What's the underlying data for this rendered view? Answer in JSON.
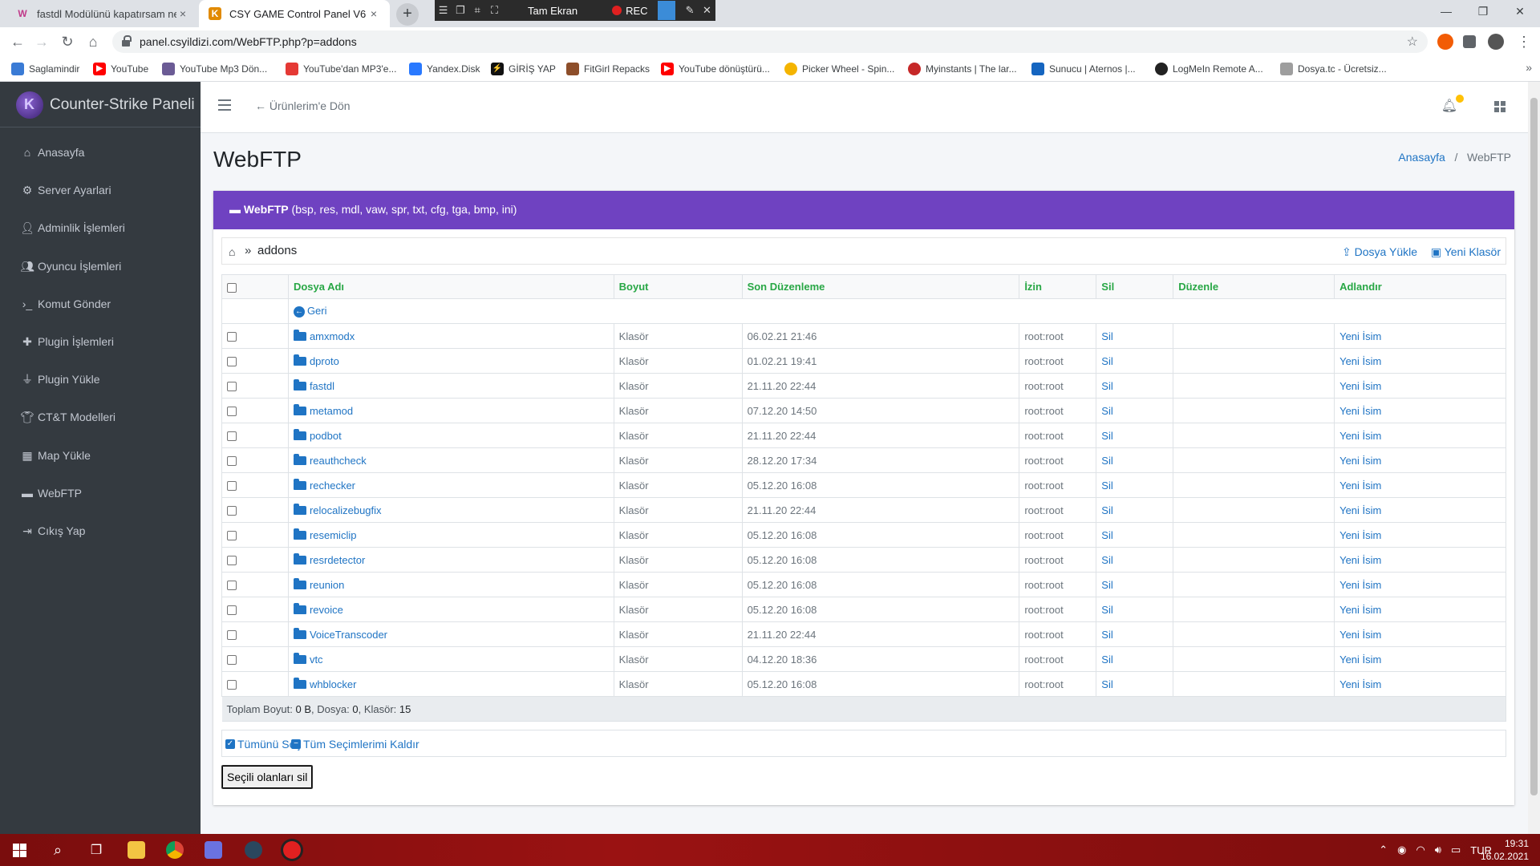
{
  "browser": {
    "tabs": [
      {
        "title": "fastdl Modülünü kapatırsam ne c",
        "active": false
      },
      {
        "title": "CSY GAME Control Panel V6",
        "active": true
      }
    ],
    "recorder": {
      "title": "Tam Ekran",
      "rec_label": "REC"
    },
    "url": "panel.csyildizi.com/WebFTP.php?p=addons",
    "bookmarks": [
      {
        "label": "Saglamindir",
        "icon_color": "#3a7bd5"
      },
      {
        "label": "YouTube",
        "icon_color": "#ff0000"
      },
      {
        "label": "YouTube Mp3 Dön...",
        "icon_color": "#6b5b95"
      },
      {
        "label": "YouTube'dan MP3'e...",
        "icon_color": "#e53935"
      },
      {
        "label": "Yandex.Disk",
        "icon_color": "#2979ff"
      },
      {
        "label": "GİRİŞ YAP",
        "icon_color": "#111111"
      },
      {
        "label": "FitGirl Repacks",
        "icon_color": "#8d4e2a"
      },
      {
        "label": "YouTube dönüştürü...",
        "icon_color": "#ff0000"
      },
      {
        "label": "Picker Wheel - Spin...",
        "icon_color": "#f4b400"
      },
      {
        "label": "Myinstants | The lar...",
        "icon_color": "#c62828"
      },
      {
        "label": "Sunucu | Aternos |...",
        "icon_color": "#1565c0"
      },
      {
        "label": "LogMeIn Remote A...",
        "icon_color": "#222222"
      },
      {
        "label": "Dosya.tc - Ücretsiz...",
        "icon_color": "#9e9e9e"
      }
    ]
  },
  "sidebar": {
    "brand": "Counter-Strike Paneli",
    "items": [
      {
        "label": "Anasayfa",
        "icon": "home-icon"
      },
      {
        "label": "Server Ayarlari",
        "icon": "cogs-icon"
      },
      {
        "label": "Adminlik İşlemleri",
        "icon": "user-icon"
      },
      {
        "label": "Oyuncu İşlemleri",
        "icon": "users-icon"
      },
      {
        "label": "Komut Gönder",
        "icon": "terminal-icon"
      },
      {
        "label": "Plugin İşlemleri",
        "icon": "puzzle-icon"
      },
      {
        "label": "Plugin Yükle",
        "icon": "plug-icon"
      },
      {
        "label": "CT&T Modelleri",
        "icon": "shirt-icon"
      },
      {
        "label": "Map Yükle",
        "icon": "map-icon"
      },
      {
        "label": "WebFTP",
        "icon": "folder-open-icon"
      },
      {
        "label": "Cıkış Yap",
        "icon": "sign-out-icon"
      }
    ]
  },
  "topnav": {
    "back_label": "Ürünlerim'e Dön"
  },
  "page": {
    "title": "WebFTP",
    "breadcrumb": {
      "home": "Anasayfa",
      "current": "WebFTP"
    }
  },
  "card": {
    "header_bold": "WebFTP",
    "header_rest": " (bsp, res, mdl, vaw, spr, txt, cfg, tga, bmp, ini)",
    "path": "addons",
    "upload_label": "Dosya Yükle",
    "new_folder_label": "Yeni Klasör",
    "columns": [
      "Dosya Adı",
      "Boyut",
      "Son Düzenleme",
      "İzin",
      "Sil",
      "Düzenle",
      "Adlandır"
    ],
    "back_label": "Geri",
    "rows": [
      {
        "name": "amxmodx",
        "size": "Klasör",
        "modified": "06.02.21 21:46",
        "perm": "root:root",
        "delete": "Sil",
        "edit": "",
        "rename": "Yeni İsim"
      },
      {
        "name": "dproto",
        "size": "Klasör",
        "modified": "01.02.21 19:41",
        "perm": "root:root",
        "delete": "Sil",
        "edit": "",
        "rename": "Yeni İsim"
      },
      {
        "name": "fastdl",
        "size": "Klasör",
        "modified": "21.11.20 22:44",
        "perm": "root:root",
        "delete": "Sil",
        "edit": "",
        "rename": "Yeni İsim"
      },
      {
        "name": "metamod",
        "size": "Klasör",
        "modified": "07.12.20 14:50",
        "perm": "root:root",
        "delete": "Sil",
        "edit": "",
        "rename": "Yeni İsim"
      },
      {
        "name": "podbot",
        "size": "Klasör",
        "modified": "21.11.20 22:44",
        "perm": "root:root",
        "delete": "Sil",
        "edit": "",
        "rename": "Yeni İsim"
      },
      {
        "name": "reauthcheck",
        "size": "Klasör",
        "modified": "28.12.20 17:34",
        "perm": "root:root",
        "delete": "Sil",
        "edit": "",
        "rename": "Yeni İsim"
      },
      {
        "name": "rechecker",
        "size": "Klasör",
        "modified": "05.12.20 16:08",
        "perm": "root:root",
        "delete": "Sil",
        "edit": "",
        "rename": "Yeni İsim"
      },
      {
        "name": "relocalizebugfix",
        "size": "Klasör",
        "modified": "21.11.20 22:44",
        "perm": "root:root",
        "delete": "Sil",
        "edit": "",
        "rename": "Yeni İsim"
      },
      {
        "name": "resemiclip",
        "size": "Klasör",
        "modified": "05.12.20 16:08",
        "perm": "root:root",
        "delete": "Sil",
        "edit": "",
        "rename": "Yeni İsim"
      },
      {
        "name": "resrdetector",
        "size": "Klasör",
        "modified": "05.12.20 16:08",
        "perm": "root:root",
        "delete": "Sil",
        "edit": "",
        "rename": "Yeni İsim"
      },
      {
        "name": "reunion",
        "size": "Klasör",
        "modified": "05.12.20 16:08",
        "perm": "root:root",
        "delete": "Sil",
        "edit": "",
        "rename": "Yeni İsim"
      },
      {
        "name": "revoice",
        "size": "Klasör",
        "modified": "05.12.20 16:08",
        "perm": "root:root",
        "delete": "Sil",
        "edit": "",
        "rename": "Yeni İsim"
      },
      {
        "name": "VoiceTranscoder",
        "size": "Klasör",
        "modified": "21.11.20 22:44",
        "perm": "root:root",
        "delete": "Sil",
        "edit": "",
        "rename": "Yeni İsim"
      },
      {
        "name": "vtc",
        "size": "Klasör",
        "modified": "04.12.20 18:36",
        "perm": "root:root",
        "delete": "Sil",
        "edit": "",
        "rename": "Yeni İsim"
      },
      {
        "name": "whblocker",
        "size": "Klasör",
        "modified": "05.12.20 16:08",
        "perm": "root:root",
        "delete": "Sil",
        "edit": "",
        "rename": "Yeni İsim"
      }
    ],
    "summary": {
      "size_label": "Toplam Boyut:",
      "size_value": "0 B",
      "files_label": "Dosya:",
      "files_value": "0",
      "folders_label": "Klasör:",
      "folders_value": "15"
    },
    "select_all_label": "Tümünü Seç",
    "deselect_all_label": "Tüm Seçimlerimi Kaldır",
    "delete_selected_label": "Seçili olanları sil"
  },
  "taskbar": {
    "lang": "TUR",
    "time": "19:31",
    "date": "16.02.2021"
  },
  "colors": {
    "sidebar_bg": "#343a40",
    "card_header": "#6f42c1",
    "table_header_text": "#28a745",
    "link": "#1f74c4",
    "taskbar": "#9a1212"
  }
}
